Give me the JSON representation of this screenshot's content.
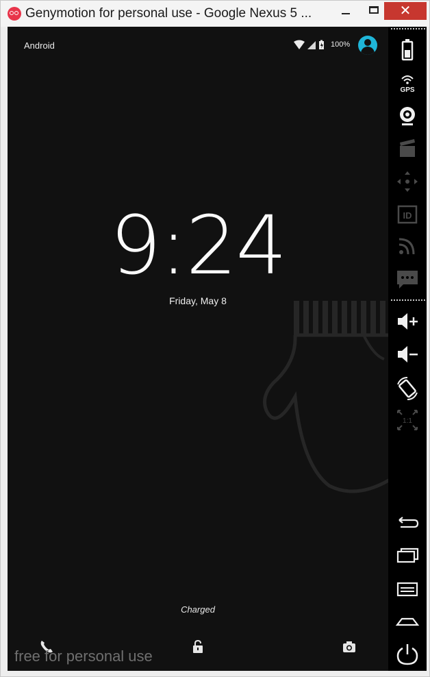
{
  "window": {
    "title": "Genymotion for personal use - Google Nexus 5 ...",
    "close_label": "✕"
  },
  "status_bar": {
    "carrier": "Android",
    "battery_percent": "100%"
  },
  "lockscreen": {
    "time_hour": "9",
    "time_sep": ":",
    "time_minute": "24",
    "date": "Friday, May 8",
    "charging_status": "Charged",
    "watermark": "free for personal use"
  },
  "sidebar": {
    "gps_label": "GPS",
    "id_label": "ID",
    "ratio_label": "1:1"
  },
  "colors": {
    "accent": "#1fb5d8",
    "close": "#c7372f",
    "screen_bg": "#111111"
  }
}
